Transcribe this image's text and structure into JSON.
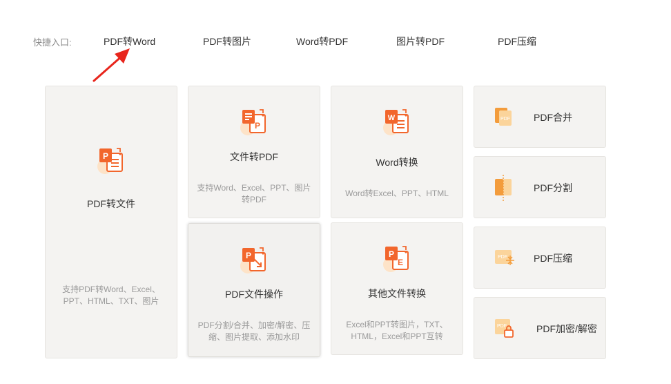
{
  "quick_entry": {
    "label": "快捷入口:",
    "links": [
      "PDF转Word",
      "PDF转图片",
      "Word转PDF",
      "图片转PDF",
      "PDF压缩"
    ]
  },
  "cards": {
    "pdf_to_file": {
      "title": "PDF转文件",
      "desc": "支持PDF转Word、Excel、PPT、HTML、TXT、图片"
    },
    "file_to_pdf": {
      "title": "文件转PDF",
      "desc": "支持Word、Excel、PPT、图片转PDF"
    },
    "pdf_file_ops": {
      "title": "PDF文件操作",
      "desc": "PDF分割/合并、加密/解密、压缩、图片提取、添加水印"
    },
    "word_convert": {
      "title": "Word转换",
      "desc": "Word转Excel、PPT、HTML"
    },
    "other_convert": {
      "title": "其他文件转换",
      "desc": "Excel和PPT转图片，TXT、HTML，Excel和PPT互转"
    }
  },
  "tools": {
    "merge": "PDF合并",
    "split": "PDF分割",
    "compress": "PDF压缩",
    "encrypt": "PDF加密/解密"
  },
  "icon_labels": {
    "pdf": "PDF"
  },
  "colors": {
    "accent": "#f2662c",
    "accent_light": "#fbd49b",
    "arrow": "#e8251c"
  }
}
